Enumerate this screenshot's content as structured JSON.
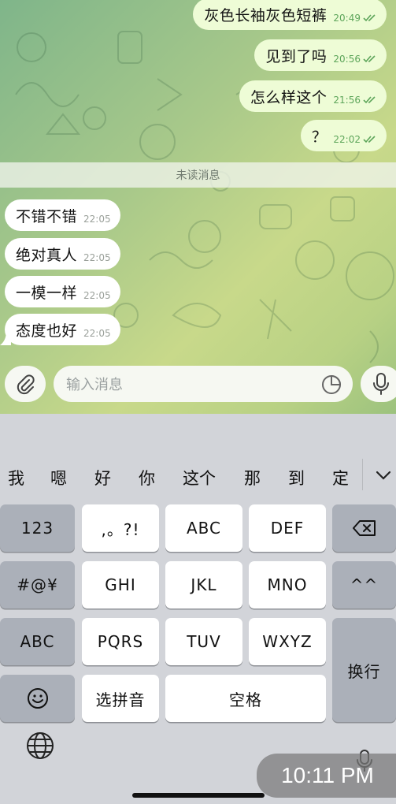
{
  "chat": {
    "outgoing": [
      {
        "text": "灰色长袖灰色短裤",
        "time": "20:49"
      },
      {
        "text": "见到了吗",
        "time": "20:56"
      },
      {
        "text": "怎么样这个",
        "time": "21:56"
      },
      {
        "text": "？",
        "time": "22:02"
      }
    ],
    "unread_label": "未读消息",
    "incoming": [
      {
        "text": "不错不错",
        "time": "22:05"
      },
      {
        "text": "绝对真人",
        "time": "22:05"
      },
      {
        "text": "一模一样",
        "time": "22:05"
      },
      {
        "text": "态度也好",
        "time": "22:05"
      }
    ],
    "input": {
      "placeholder": "输入消息"
    }
  },
  "keyboard": {
    "candidates": [
      "我",
      "嗯",
      "好",
      "你",
      "这个",
      "那",
      "到",
      "定"
    ],
    "row1": {
      "left": "123",
      "k1": ",。?!",
      "k2": "ABC",
      "k3": "DEF",
      "right": "⌫"
    },
    "row2": {
      "left": "#@¥",
      "k1": "GHI",
      "k2": "JKL",
      "k3": "MNO",
      "right": "^^"
    },
    "row3": {
      "left": "ABC",
      "k1": "PQRS",
      "k2": "TUV",
      "k3": "WXYZ"
    },
    "row4": {
      "left": "☺",
      "k1": "选拼音",
      "space": "空格"
    },
    "enter": "换行"
  },
  "status": {
    "time": "10:11 PM"
  },
  "colors": {
    "outgoing_bubble": "#eefcd6",
    "incoming_bubble": "#ffffff",
    "tick": "#5da55a"
  }
}
